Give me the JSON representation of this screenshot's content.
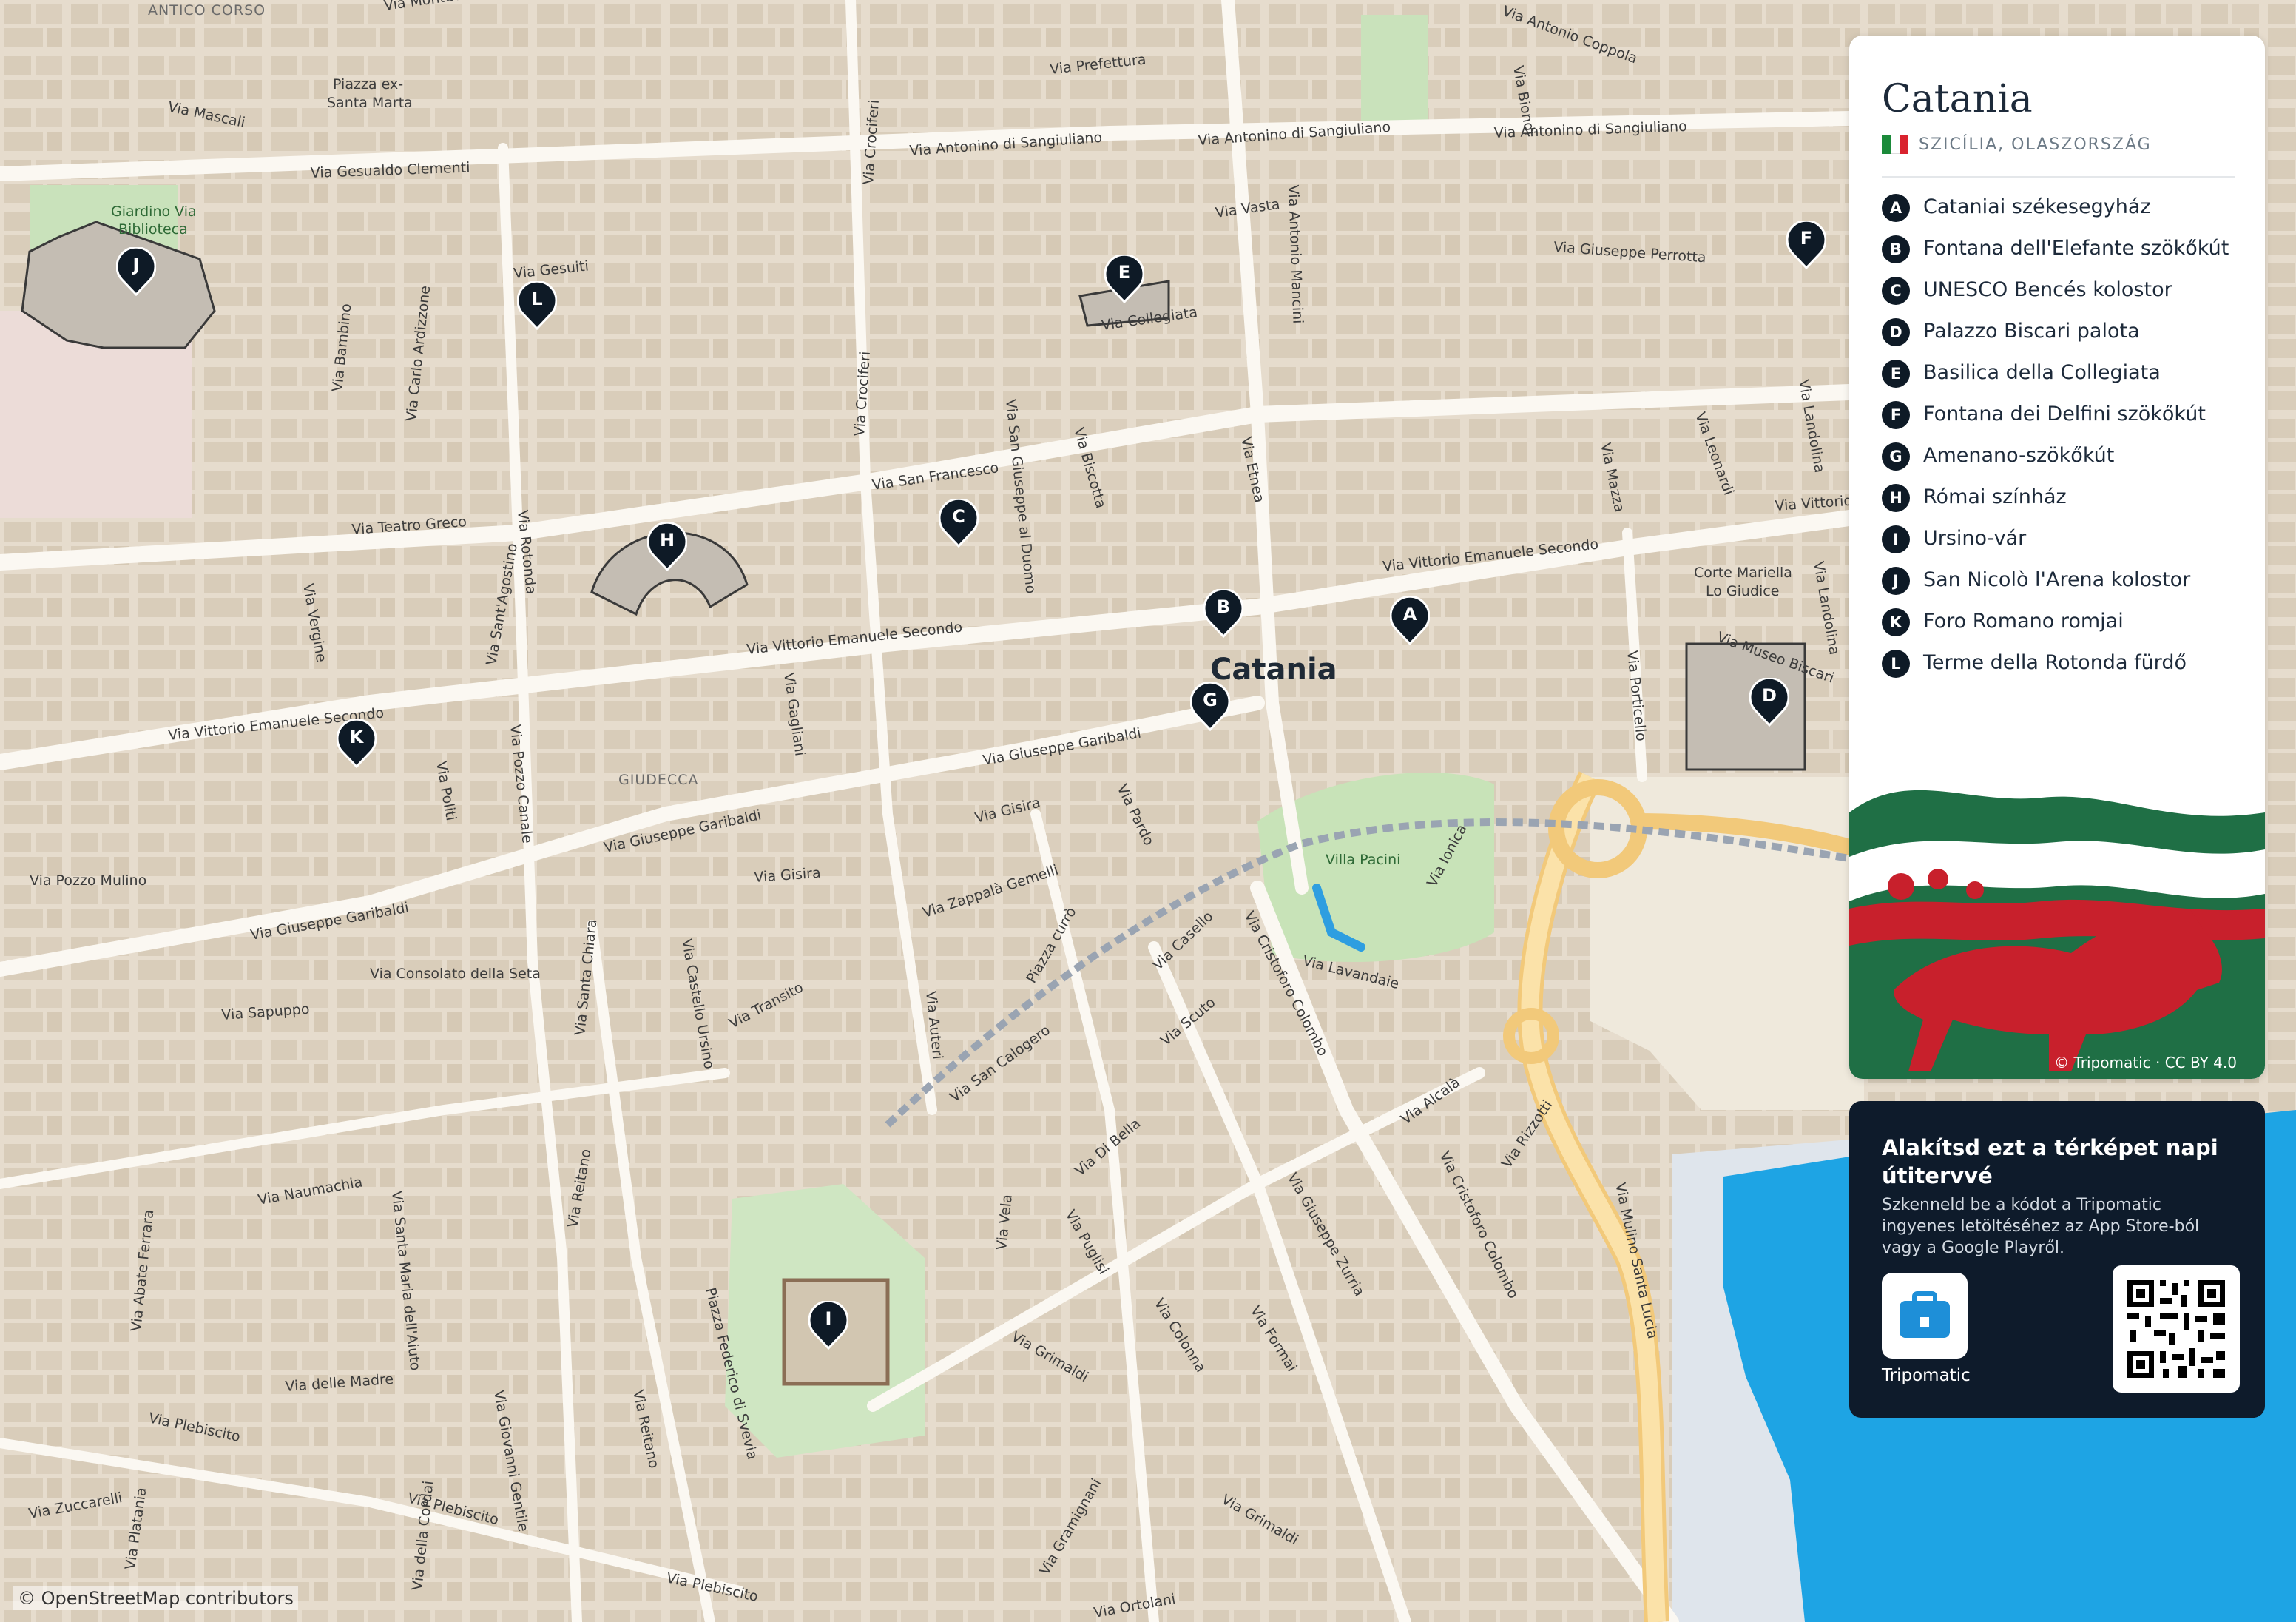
{
  "city_name": "Catania",
  "region": "SZICÍLIA, OLASZORSZÁG",
  "country_flag_colors": [
    "#1b8a3a",
    "#ffffff",
    "#d9232e"
  ],
  "map_city_label": "Catania",
  "attribution": "© OpenStreetMap contributors",
  "art_credit": "© Tripomatic · CC BY 4.0",
  "accent_color": "#0e1a26",
  "places": [
    {
      "letter": "A",
      "name": "Cataniai székesegyház"
    },
    {
      "letter": "B",
      "name": "Fontana dell'Elefante szökőkút"
    },
    {
      "letter": "C",
      "name": "UNESCO Bencés kolostor"
    },
    {
      "letter": "D",
      "name": "Palazzo Biscari palota"
    },
    {
      "letter": "E",
      "name": "Basilica della Collegiata"
    },
    {
      "letter": "F",
      "name": "Fontana dei Delfini szökőkút"
    },
    {
      "letter": "G",
      "name": "Amenano-szökőkút"
    },
    {
      "letter": "H",
      "name": "Római színház"
    },
    {
      "letter": "I",
      "name": "Ursino-vár"
    },
    {
      "letter": "J",
      "name": "San Nicolò l'Arena kolostor"
    },
    {
      "letter": "K",
      "name": "Foro Romano romjai"
    },
    {
      "letter": "L",
      "name": "Terme della Rotonda fürdő"
    }
  ],
  "streets": [
    "ANTICO CORSO",
    "Via Monteverde",
    "Via Mascali",
    "Piazza ex-",
    "Santa Marta",
    "Via Gesualdo Clementi",
    "Giardino Via",
    "Biblioteca",
    "Via Gesuiti",
    "Via Bambino",
    "Via Carlo Ardizzone",
    "Via Rotonda",
    "Via Teatro Greco",
    "Via Sant'Agostino",
    "Via Vergine",
    "Via Vittorio Emanuele Secondo",
    "Via Pozzo Canale",
    "Via Politi",
    "GIUDECCA",
    "Via Giuseppe Garibaldi",
    "Via Pozzo Mulino",
    "Via Consolato della Seta",
    "Via Sapuppo",
    "Via Santa Chiara",
    "Via Castello Ursino",
    "Via Transito",
    "Via Gisira",
    "Via Zappalà Gemelli",
    "Piazza currò",
    "Via San Calogero",
    "Via Auteri",
    "Via Naumachia",
    "Via Abate Ferrara",
    "Via Santa Maria dell'Aiuto",
    "Via delle Madre",
    "Via Plebiscito",
    "Via Zuccarelli",
    "Via Platania",
    "Via Giovanni Gentile",
    "Via Reitano",
    "Piazza Federico di Svevia",
    "Via della Cordai",
    "Via Prefettura",
    "Via Antonino di Sangiuliano",
    "Via Crociferi",
    "Via San Francesco",
    "Via San Giuseppe al Duomo",
    "Via Biscotta",
    "Via Collegiata",
    "Via Vasta",
    "Via Antonio Mancini",
    "Via Etnea",
    "Via Gagliani",
    "Via Pardo",
    "Via Mazza",
    "Via Leonardi",
    "Via Landolina",
    "Via Museo Biscari",
    "Via Porticello",
    "Corte Mariella",
    "Lo Giudice",
    "Via Biondi",
    "Via Antonio Coppola",
    "Via Giuseppe Perrotta",
    "Via Casello",
    "Via Cristoforo Colombo",
    "Via Lavandaie",
    "Villa Pacini",
    "Via Ionica",
    "Via Scuto",
    "Via Di Bella",
    "Via Vela",
    "Via Puglisi",
    "Via Colonna",
    "Via Formai",
    "Via Grimaldi",
    "Via Giuseppe Zurria",
    "Via Alcalà",
    "Via Rizzotti",
    "Via Mulino Santa Lucia",
    "Via Gramignani",
    "Via Ortolani",
    "Via Vittorio"
  ],
  "promo": {
    "title": "Alakítsd ezt a térképet napi útitervvé",
    "description": "Szkenneld be a kódot a Tripomatic ingyenes letöltéséhez az App Store-ból vagy a Google Playről.",
    "app_name": "Tripomatic"
  }
}
